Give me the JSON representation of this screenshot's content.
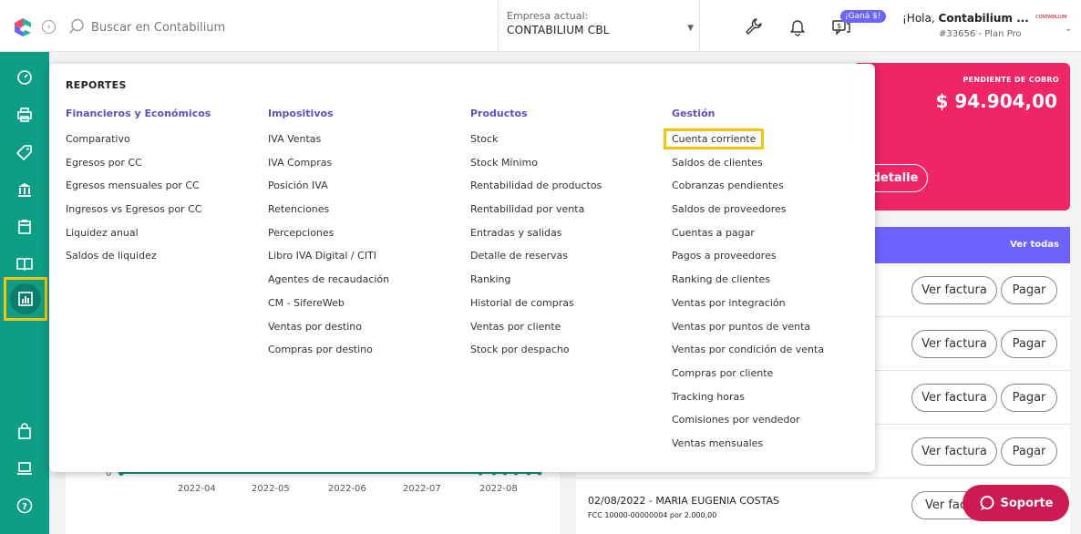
{
  "topbar": {
    "search_placeholder": "Buscar en Contabilium",
    "company_label": "Empresa actual:",
    "company_name": "CONTABILIUM CBL",
    "badge": "¡Ganá $!",
    "hello_prefix": "¡Hola,",
    "user_name": "Contabilium ...",
    "plan": "#33656 - Plan Pro",
    "mini_logo": "CONTABILIUM"
  },
  "sidebar": {
    "items": [
      "dashboard-icon",
      "printer-icon",
      "tag-icon",
      "bank-icon",
      "calendar-icon",
      "book-icon",
      "chart-icon",
      "bag-icon",
      "laptop-icon",
      "help-icon"
    ],
    "active": "chart-icon"
  },
  "pending": {
    "label": "PENDIENTE DE COBRO",
    "amount": "$ 94.904,00",
    "button": "detalle"
  },
  "list": {
    "ver_todas": "Ver todas",
    "ver_factura": "Ver factura",
    "pagar": "Pagar",
    "last_title": "02/08/2022 - MARIA EUGENIA COSTAS",
    "last_sub": "FCC 10000-00000004 por 2.000,00",
    "last_button": "Ver fac"
  },
  "chart_data": {
    "type": "line",
    "x": [
      "2022-04",
      "2022-05",
      "2022-06",
      "2022-07",
      "2022-08"
    ],
    "y_tick": "0"
  },
  "soporte": "Soporte",
  "menu": {
    "title": "REPORTES",
    "columns": [
      {
        "heading": "Financieros y Económicos",
        "items": [
          "Comparativo",
          "Egresos por CC",
          "Egresos mensuales por CC",
          "Ingresos vs Egresos por CC",
          "Liquidez anual",
          "Saldos de liquidez"
        ]
      },
      {
        "heading": "Impositivos",
        "items": [
          "IVA Ventas",
          "IVA Compras",
          "Posición IVA",
          "Retenciones",
          "Percepciones",
          "Libro IVA Digital / CITI",
          "Agentes de recaudación",
          "CM - SifereWeb",
          "Ventas por destino",
          "Compras por destino"
        ]
      },
      {
        "heading": "Productos",
        "items": [
          "Stock",
          "Stock Mínimo",
          "Rentabilidad de productos",
          "Rentabilidad por venta",
          "Entradas y salidas",
          "Detalle de reservas",
          "Ranking",
          "Historial de compras",
          "Ventas por cliente",
          "Stock por despacho"
        ]
      },
      {
        "heading": "Gestión",
        "items": [
          "Cuenta corriente",
          "Saldos de clientes",
          "Cobranzas pendientes",
          "Saldos de proveedores",
          "Cuentas a pagar",
          "Pagos a proveedores",
          "Ranking de clientes",
          "Ventas por integración",
          "Ventas por puntos de venta",
          "Ventas por condición de venta",
          "Compras por cliente",
          "Tracking horas",
          "Comisiones por vendedor",
          "Ventas mensuales"
        ]
      }
    ],
    "highlighted": "Cuenta corriente"
  }
}
